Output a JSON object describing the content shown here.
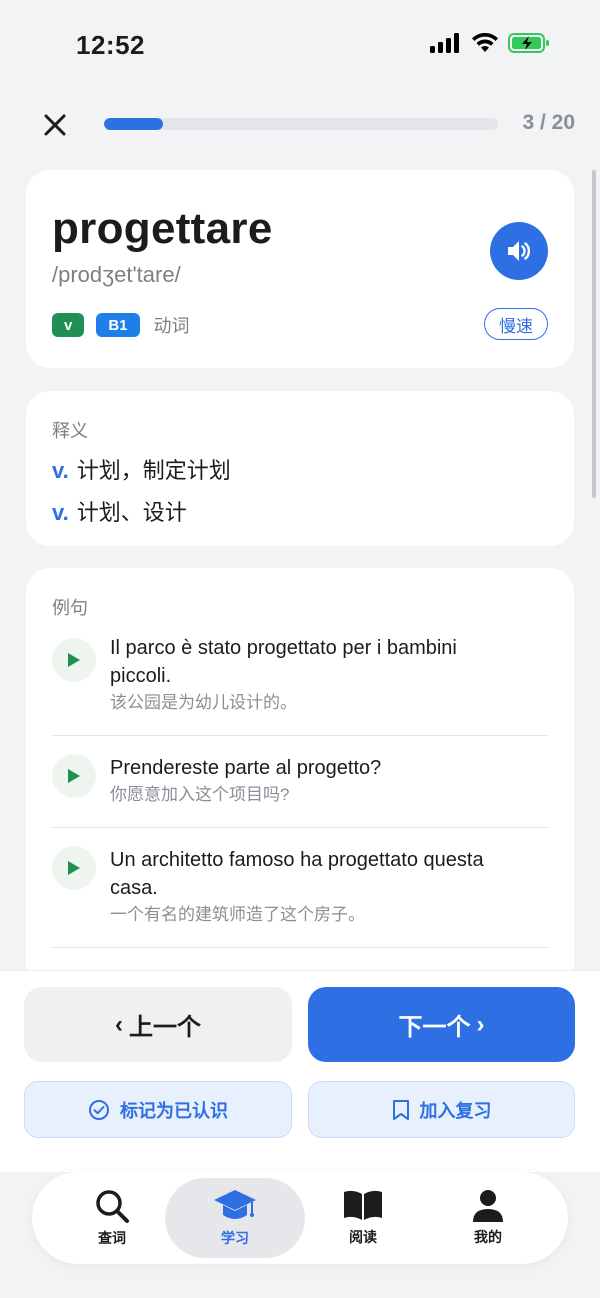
{
  "status_bar": {
    "time": "12:52"
  },
  "header": {
    "progress_text": "3 / 20",
    "progress_fraction": 0.15
  },
  "word_card": {
    "word": "progettare",
    "phonetic": "/prodʒet'tare/",
    "tag_pos": "v",
    "tag_level": "B1",
    "pos_label": "动词",
    "slow_label": "慢速"
  },
  "definitions": {
    "title": "释义",
    "items": [
      {
        "pos": "v.",
        "text": "计划，制定计划"
      },
      {
        "pos": "v.",
        "text": "计划、设计"
      }
    ]
  },
  "examples": {
    "title": "例句",
    "items": [
      {
        "it": "Il parco è stato progettato per i bambini piccoli.",
        "zh": "该公园是为幼儿设计的。"
      },
      {
        "it": "Prendereste parte al progetto?",
        "zh": "你愿意加入这个项目吗?"
      },
      {
        "it": "Un architetto famoso ha progettato questa casa.",
        "zh": "一个有名的建筑师造了这个房子。"
      }
    ]
  },
  "actions": {
    "prev_label": "上一个",
    "next_label": "下一个",
    "known_label": "标记为已认识",
    "review_label": "加入复习"
  },
  "tabs": [
    {
      "label": "查词",
      "icon": "search-icon"
    },
    {
      "label": "学习",
      "icon": "graduation-cap-icon",
      "active": true
    },
    {
      "label": "阅读",
      "icon": "book-icon"
    },
    {
      "label": "我的",
      "icon": "person-icon"
    }
  ],
  "colors": {
    "accent": "#2f6fe4",
    "tag_green": "#1f8f53",
    "tag_blue": "#1f7fe8",
    "background": "#f2f3f5"
  }
}
